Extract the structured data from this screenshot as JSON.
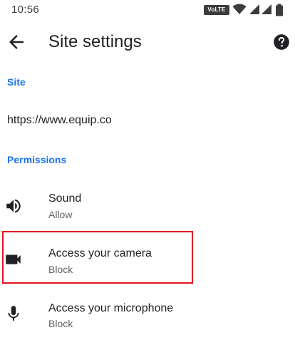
{
  "status_bar": {
    "time": "10:56",
    "volte_label": "VoLTE",
    "icons": [
      "volte-icon",
      "wifi-icon",
      "signal-icon",
      "signal-icon",
      "battery-icon"
    ]
  },
  "toolbar": {
    "title": "Site settings",
    "back_icon": "arrow-back-icon",
    "help_icon": "help-icon"
  },
  "site": {
    "header": "Site",
    "url": "https://www.equip.co"
  },
  "permissions": {
    "header": "Permissions",
    "items": [
      {
        "icon": "speaker-icon",
        "title": "Sound",
        "value": "Allow"
      },
      {
        "icon": "videocam-icon",
        "title": "Access your camera",
        "value": "Block"
      },
      {
        "icon": "mic-icon",
        "title": "Access your microphone",
        "value": "Block"
      }
    ]
  },
  "colors": {
    "accent": "#1a73e8",
    "highlight": "#e3141f",
    "text_primary": "#202124",
    "text_secondary": "#5f6368"
  }
}
